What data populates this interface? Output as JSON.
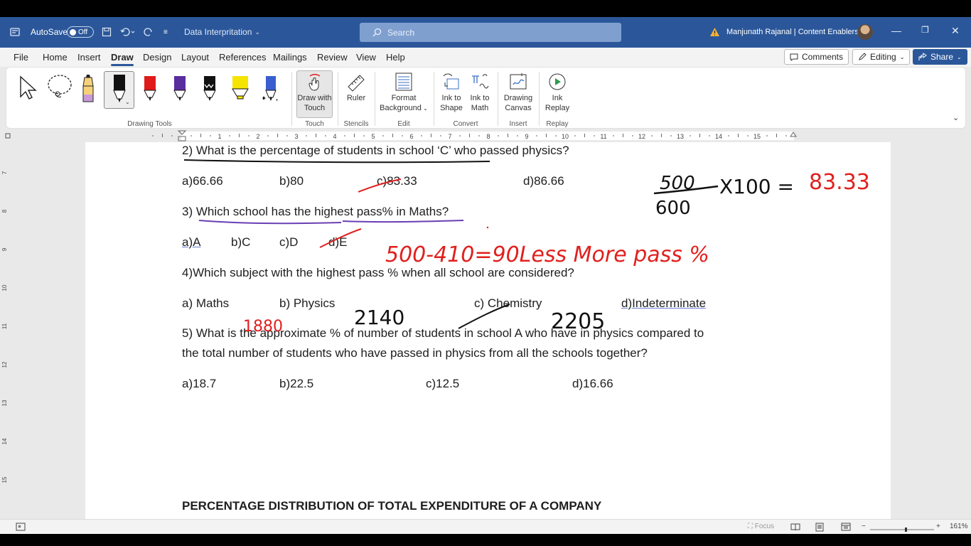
{
  "titlebar": {
    "autosave_label": "AutoSave",
    "autosave_state": "Off",
    "doc_title": "Data Interpritation",
    "search_placeholder": "Search",
    "user": "Manjunath Rajanal | Content Enablers"
  },
  "menu": {
    "tabs": [
      "File",
      "Home",
      "Insert",
      "Draw",
      "Design",
      "Layout",
      "References",
      "Mailings",
      "Review",
      "View",
      "Help"
    ],
    "active_tab": "Draw",
    "comments": "Comments",
    "editing": "Editing",
    "share": "Share"
  },
  "ribbon": {
    "groups": {
      "drawing_tools": "Drawing Tools",
      "touch": "Touch",
      "stencils": "Stencils",
      "edit": "Edit",
      "convert": "Convert",
      "insert": "Insert",
      "replay": "Replay"
    },
    "buttons": {
      "draw_with_touch_1": "Draw with",
      "draw_with_touch_2": "Touch",
      "ruler": "Ruler",
      "format_bg_1": "Format",
      "format_bg_2": "Background",
      "ink_to_shape_1": "Ink to",
      "ink_to_shape_2": "Shape",
      "ink_to_math_1": "Ink to",
      "ink_to_math_2": "Math",
      "drawing_canvas_1": "Drawing",
      "drawing_canvas_2": "Canvas",
      "ink_replay_1": "Ink",
      "ink_replay_2": "Replay"
    },
    "pens": [
      {
        "name": "pencil-yellow-purple",
        "color": "#8a5bb5"
      },
      {
        "name": "pen-black",
        "color": "#111111"
      },
      {
        "name": "pen-red",
        "color": "#e01b1b"
      },
      {
        "name": "pen-purple",
        "color": "#5a2d9e"
      },
      {
        "name": "pen-black-2",
        "color": "#111111"
      },
      {
        "name": "highlighter-yellow",
        "color": "#f4e400"
      },
      {
        "name": "pen-galaxy",
        "color": "#3a5ed0"
      }
    ]
  },
  "ruler": {
    "numbers": [
      "1",
      "2",
      "3",
      "4",
      "5",
      "6",
      "7",
      "8",
      "9",
      "10",
      "11",
      "12",
      "13",
      "14",
      "15"
    ],
    "vnumbers": [
      "7",
      "8",
      "9",
      "10",
      "11",
      "12",
      "13",
      "14",
      "15"
    ]
  },
  "document": {
    "q2": {
      "prefix": "2) ",
      "question": "What is the percentage of students in school ‘C’",
      "suffix": " who passed physics?",
      "a": "a)66.66",
      "b": "b)80",
      "c": "c)83.33",
      "d": "d)86.66"
    },
    "q3": {
      "prefix": "3) ",
      "question": "Which school has the highest pass% in Maths?",
      "a": "a)A",
      "b": "b)C",
      "c": "c)D",
      "d": "d)E"
    },
    "q4": {
      "question": "4)Which subject with the highest pass % when all school are considered?",
      "a": "a) Maths",
      "b": "b) Physics",
      "c": "c) Chemistry",
      "d": "d)Indeterminate"
    },
    "q5": {
      "line1": "5) What is the approximate % of number of students in school A who have in physics compared to",
      "line2": "the total number of students who have passed in physics from all the schools together?",
      "a": "a)18.7",
      "b": "b)22.5",
      "c": "c)12.5",
      "d": "d)16.66"
    },
    "heading": "PERCENTAGE DISTRIBUTION OF TOTAL EXPENDITURE OF A COMPANY"
  },
  "ink": {
    "frac_num": "500",
    "frac_den": "600",
    "times": "X100 =",
    "result": "83.33",
    "q3_note": "500-410=90Less More pass %",
    "q4_maths": "1880",
    "q4_physics": "2140",
    "q4_chem": "2205",
    "colors": {
      "red": "#e0201e",
      "black": "#111111",
      "purple": "#6a3fb5"
    }
  },
  "status": {
    "focus": "Focus",
    "zoom": "161%"
  }
}
